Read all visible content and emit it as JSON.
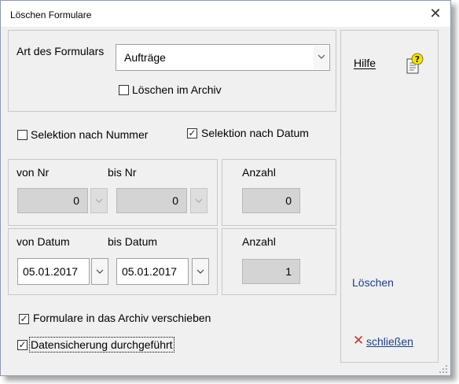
{
  "window": {
    "title": "Löschen Formulare",
    "close_glyph": "✕"
  },
  "form_type": {
    "label": "Art des Formulars",
    "selected": "Aufträge",
    "archive_delete_label": "Löschen im Archiv",
    "archive_delete_checked": false
  },
  "selection": {
    "by_number_label": "Selektion nach Nummer",
    "by_number_checked": false,
    "by_date_label": "Selektion nach Datum",
    "by_date_checked": true
  },
  "number_range": {
    "from_label": "von Nr",
    "from_value": "0",
    "to_label": "bis Nr",
    "to_value": "0",
    "count_label": "Anzahl",
    "count_value": "0"
  },
  "date_range": {
    "from_label": "von Datum",
    "from_value": "05.01.2017",
    "to_label": "bis Datum",
    "to_value": "05.01.2017",
    "count_label": "Anzahl",
    "count_value": "1"
  },
  "options": {
    "move_to_archive_label": "Formulare in das Archiv verschieben",
    "move_to_archive_checked": true,
    "backup_done_label": "Datensicherung durchgeführt",
    "backup_done_checked": true
  },
  "sidebar": {
    "help_label": "Hilfe",
    "help_icon": "help-document-icon",
    "delete_label": "Löschen",
    "close_label": "schließen",
    "close_icon": "red-x-icon"
  },
  "colors": {
    "link": "#1e3f8a",
    "close_x": "#c0392b",
    "help_icon_yellow": "#f5e400"
  }
}
